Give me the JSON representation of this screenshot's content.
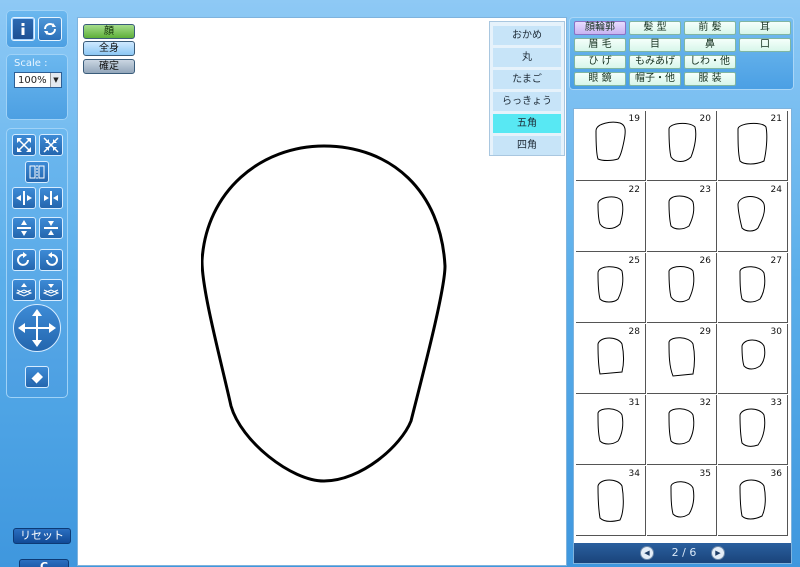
{
  "left_panel": {
    "scale_label": "Scale :",
    "scale_value": "100%",
    "reset_label": "リセット",
    "c_label": "C"
  },
  "canvas": {
    "view_buttons": [
      "顔",
      "全身",
      "確定"
    ],
    "active_view": "顔",
    "shape_options": [
      "おかめ",
      "丸",
      "たまご",
      "らっきょう",
      "五角",
      "四角"
    ],
    "selected_shape": "五角"
  },
  "categories": [
    [
      "顔輪郭",
      "髪 型",
      "前 髪",
      "耳"
    ],
    [
      "眉 毛",
      "目",
      "鼻",
      "口"
    ],
    [
      "ひ げ",
      "もみあげ",
      "しわ・他"
    ],
    [
      "眼 鏡",
      "帽子・他",
      "服 装"
    ]
  ],
  "selected_category": "顔輪郭",
  "parts": {
    "numbers": [
      "19",
      "20",
      "21",
      "22",
      "23",
      "24",
      "25",
      "26",
      "27",
      "28",
      "29",
      "30",
      "31",
      "32",
      "33",
      "34",
      "35",
      "36"
    ],
    "page_text": "2 / 6"
  },
  "icons": {
    "cursor": "cursor-icon",
    "rotate": "rotate-icon",
    "dropdown": "chevron-down-icon",
    "pager_prev": "triangle-left-icon",
    "pager_next": "triangle-right-icon"
  }
}
